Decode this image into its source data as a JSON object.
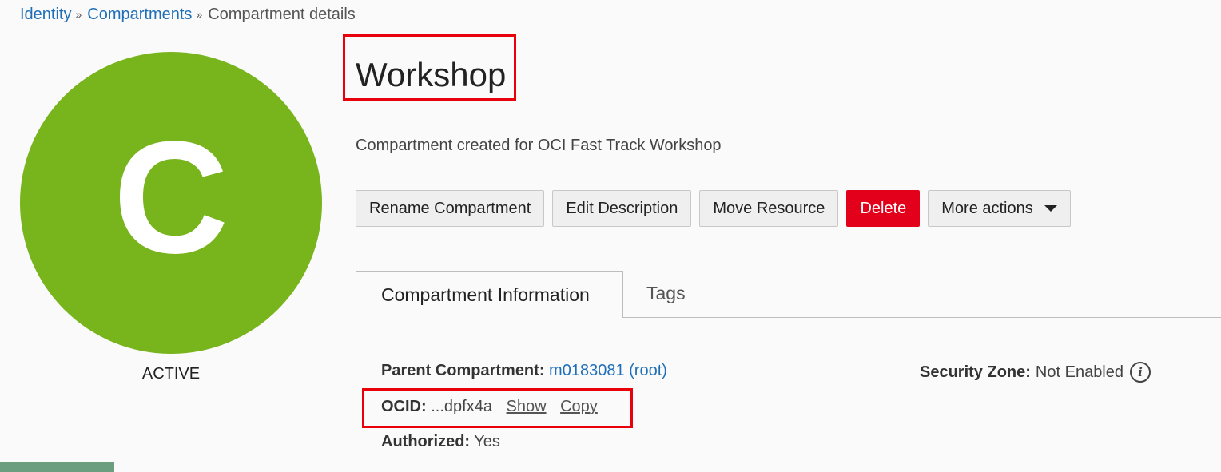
{
  "breadcrumb": {
    "items": [
      "Identity",
      "Compartments"
    ],
    "separator": "»",
    "current": "Compartment details"
  },
  "avatar": {
    "letter": "C",
    "color": "#78b41c",
    "status": "ACTIVE"
  },
  "compartment": {
    "name": "Workshop",
    "description": "Compartment created for OCI Fast Track Workshop"
  },
  "actions": {
    "rename": "Rename Compartment",
    "edit_description": "Edit Description",
    "move_resource": "Move Resource",
    "delete": "Delete",
    "more_actions": "More actions"
  },
  "tabs": {
    "info": "Compartment Information",
    "tags": "Tags"
  },
  "info": {
    "parent_label": "Parent Compartment:",
    "parent_value": "m0183081 (root)",
    "ocid_label": "OCID:",
    "ocid_value": "...dpfx4a",
    "ocid_show": "Show",
    "ocid_copy": "Copy",
    "authorized_label": "Authorized:",
    "authorized_value": "Yes",
    "security_zone_label": "Security Zone:",
    "security_zone_value": "Not Enabled",
    "info_icon": "info-icon"
  },
  "colors": {
    "link": "#1f6fb8",
    "danger": "#e3001b",
    "highlight": "#e8000b"
  }
}
